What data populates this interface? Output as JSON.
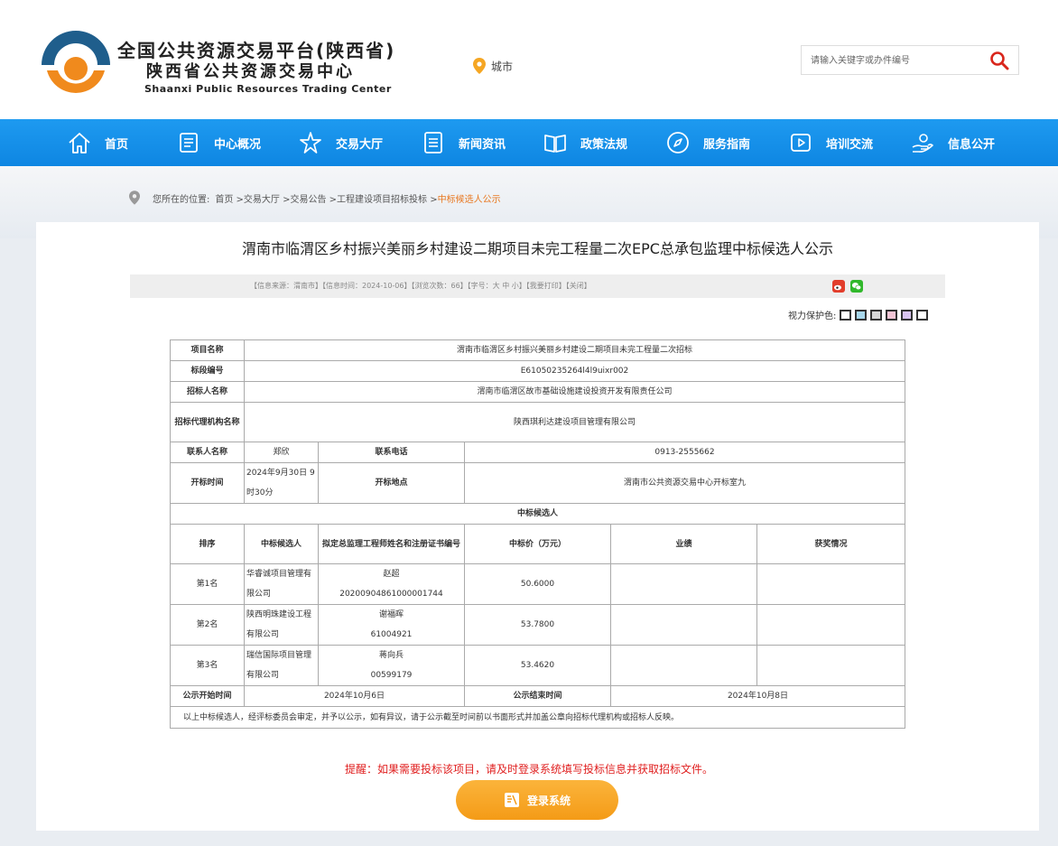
{
  "header": {
    "title1": "全国公共资源交易平台(陕西省)",
    "title2": "陕西省公共资源交易中心",
    "title3": "Shaanxi Public Resources Trading Center",
    "city_label": "城市",
    "search_placeholder": "请输入关键字或办件编号"
  },
  "nav": [
    "首页",
    "中心概况",
    "交易大厅",
    "新闻资讯",
    "政策法规",
    "服务指南",
    "培训交流",
    "信息公开"
  ],
  "breadcrumb": {
    "prefix": "您所在的位置:",
    "path": "首页 >交易大厅 >交易公告 >工程建设项目招标投标 >",
    "current": "中标候选人公示"
  },
  "article": {
    "title": "渭南市临渭区乡村振兴美丽乡村建设二期项目未完工程量二次EPC总承包监理中标候选人公示",
    "info": "【信息来源：渭南市】【信息时间：2024-10-06】【浏览次数：66】【字号：大 中 小】【我要打印】【关闭】",
    "eye_label": "视力保护色:"
  },
  "colors": {
    "nav_blue": "#1a93ec",
    "accent_orange": "#f7a52a",
    "swatches": [
      "#ffffff",
      "#a9d8ec",
      "#d6d6d6",
      "#f3c6d6",
      "#d8c4ef",
      "#ffffff"
    ]
  },
  "table": {
    "project_name_label": "项目名称",
    "project_name": "渭南市临渭区乡村振兴美丽乡村建设二期项目未完工程量二次招标",
    "section_no_label": "标段编号",
    "section_no": "E61050235264l4l9uixr002",
    "tenderer_label": "招标人名称",
    "tenderer": "渭南市临渭区故市基础设施建设投资开发有限责任公司",
    "agency_label": "招标代理机构名称",
    "agency": "陕西琪利达建设项目管理有限公司",
    "contact_label": "联系人名称",
    "contact": "郑欣",
    "phone_label": "联系电话",
    "phone": "0913-2555662",
    "open_time_label": "开标时间",
    "open_time": "2024年9月30日 9时30分",
    "open_place_label": "开标地点",
    "open_place": "渭南市公共资源交易中心开标室九",
    "candidates_header": "中标候选人",
    "cols": [
      "排序",
      "中标候选人",
      "拟定总监理工程师姓名和注册证书编号",
      "中标价（万元）",
      "业绩",
      "获奖情况"
    ],
    "rows": [
      {
        "rank": "第1名",
        "company": "华睿诚项目管理有限公司",
        "engineer": "赵超",
        "cert": "20200904861000001744",
        "price": "50.6000",
        "perf": "",
        "award": ""
      },
      {
        "rank": "第2名",
        "company": "陕西明珠建设工程有限公司",
        "engineer": "谢福晖",
        "cert": "61004921",
        "price": "53.7800",
        "perf": "",
        "award": ""
      },
      {
        "rank": "第3名",
        "company": "瑞信国际项目管理有限公司",
        "engineer": "蒋向兵",
        "cert": "00599179",
        "price": "53.4620",
        "perf": "",
        "award": ""
      }
    ],
    "start_label": "公示开始时间",
    "start": "2024年10月6日",
    "end_label": "公示结束时间",
    "end": "2024年10月8日",
    "note": "以上中标候选人，经评标委员会审定，并予以公示，如有异议，请于公示截至时间前以书面形式并加盖公章向招标代理机构或招标人反映。"
  },
  "reminder": "提醒：如果需要投标该项目，请及时登录系统填写投标信息并获取招标文件。",
  "login_button": "登录系统"
}
